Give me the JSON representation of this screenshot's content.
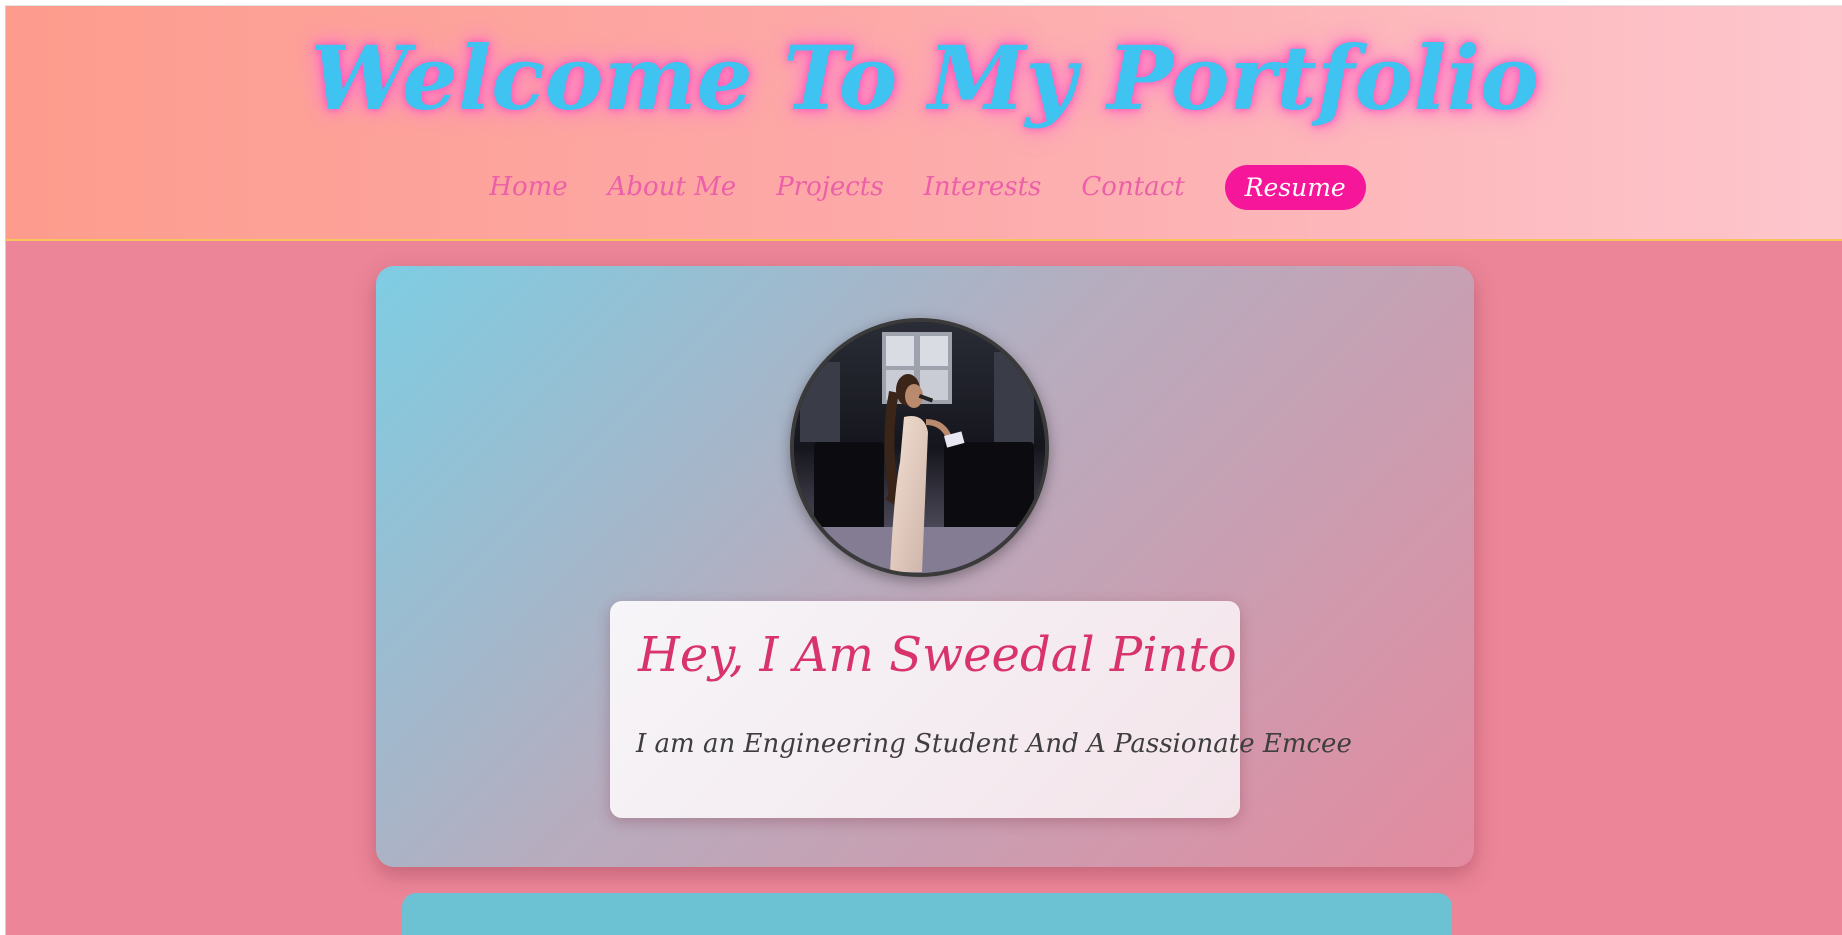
{
  "header": {
    "title": "Welcome To My Portfolio"
  },
  "nav": {
    "items": [
      {
        "label": "Home"
      },
      {
        "label": "About Me"
      },
      {
        "label": "Projects"
      },
      {
        "label": "Interests"
      },
      {
        "label": "Contact"
      }
    ],
    "resume_label": "Resume"
  },
  "hero": {
    "avatar_alt": "woman-speaking-with-microphone",
    "name": "Hey, I Am Sweedal Pinto",
    "tagline": "I am an Engineering Student And A Passionate Emcee"
  },
  "colors": {
    "title": "#3fc3f0",
    "nav_link": "#ec5fa9",
    "resume_bg": "#f5169a",
    "page_bg": "#ec8598",
    "name_text": "#d8336b",
    "next_section": "#6cc1d3"
  }
}
